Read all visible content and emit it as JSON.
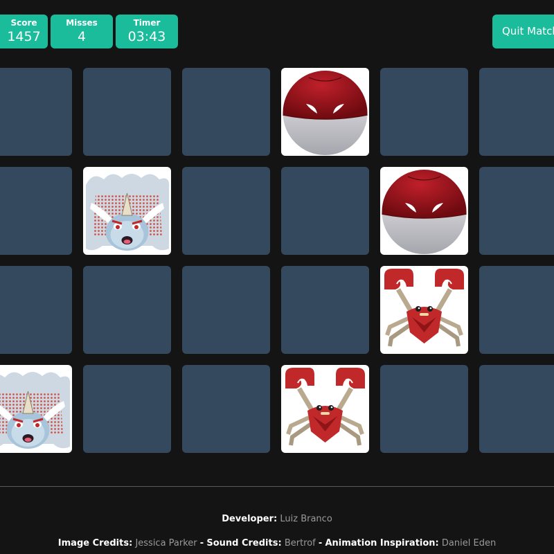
{
  "stats": {
    "score": {
      "label": "Score",
      "value": "1457"
    },
    "misses": {
      "label": "Misses",
      "value": "4"
    },
    "timer": {
      "label": "Timer",
      "value": "03:43"
    }
  },
  "quit_label": "Quit Match",
  "board": {
    "rows": 4,
    "cols": 6,
    "revealed": [
      {
        "row": 0,
        "col": 3,
        "pokemon": "voltorb"
      },
      {
        "row": 1,
        "col": 1,
        "pokemon": "vaporeon"
      },
      {
        "row": 1,
        "col": 4,
        "pokemon": "voltorb"
      },
      {
        "row": 2,
        "col": 4,
        "pokemon": "krabby"
      },
      {
        "row": 3,
        "col": 0,
        "pokemon": "vaporeon"
      },
      {
        "row": 3,
        "col": 3,
        "pokemon": "krabby"
      }
    ]
  },
  "colors": {
    "background": "#141414",
    "accent": "#1abc9c",
    "card_back": "#34495e",
    "card_face": "#ffffff"
  },
  "footer": {
    "developer_label": "Developer:",
    "developer_name": "Luiz Branco",
    "image_label": "Image Credits:",
    "image_name": "Jessica Parker",
    "sound_label": "Sound Credits:",
    "sound_name": "Bertrof",
    "animation_label": "Animation Inspiration:",
    "animation_name": "Daniel Eden",
    "separator": "-"
  }
}
